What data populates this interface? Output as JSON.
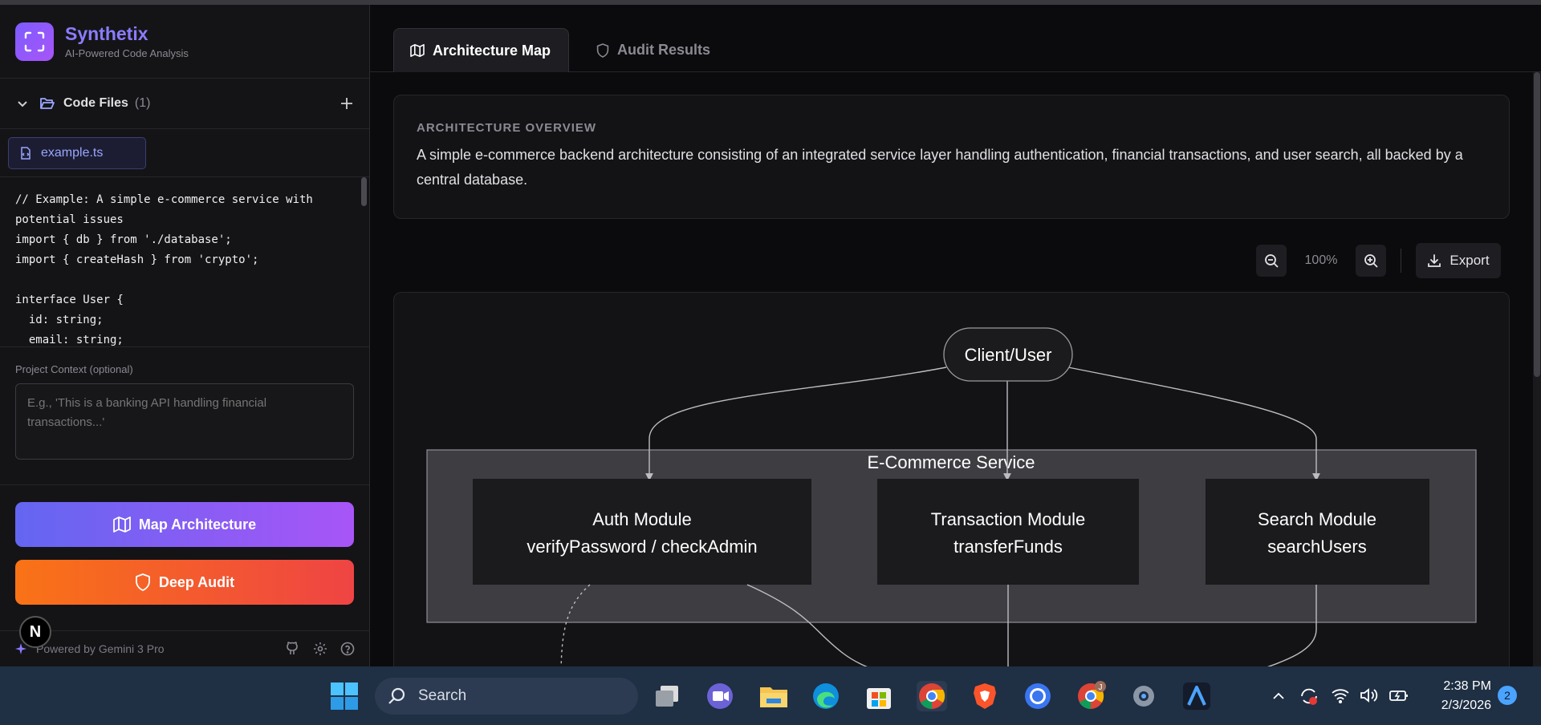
{
  "brand": {
    "name": "Synthetix",
    "tagline": "AI-Powered Code Analysis"
  },
  "files": {
    "label": "Code Files",
    "count": "(1)",
    "active_file": "example.ts"
  },
  "code": {
    "lines": [
      "// Example: A simple e-commerce service with",
      "potential issues",
      "import { db } from './database';",
      "import { createHash } from 'crypto';",
      "",
      "interface User {",
      "  id: string;",
      "  email: string;"
    ]
  },
  "context": {
    "label": "Project Context (optional)",
    "placeholder": "E.g., 'This is a banking API handling financial transactions...'"
  },
  "actions": {
    "map_label": "Map Architecture",
    "audit_label": "Deep Audit"
  },
  "footer": {
    "powered": "Powered by Gemini 3 Pro",
    "badge": "N"
  },
  "tabs": [
    {
      "label": "Architecture Map",
      "active": true
    },
    {
      "label": "Audit Results",
      "active": false
    }
  ],
  "overview": {
    "heading": "ARCHITECTURE OVERVIEW",
    "text": "A simple e-commerce backend architecture consisting of an integrated service layer handling authentication, financial transactions, and user search, all backed by a central database."
  },
  "zoom": {
    "level": "100%",
    "export_label": "Export"
  },
  "diagram": {
    "client": "Client/User",
    "service": "E-Commerce Service",
    "modules": [
      {
        "name": "Auth Module",
        "detail": "verifyPassword / checkAdmin"
      },
      {
        "name": "Transaction Module",
        "detail": "transferFunds"
      },
      {
        "name": "Search Module",
        "detail": "searchUsers"
      }
    ]
  },
  "taskbar": {
    "search_label": "Search",
    "time": "2:38 PM",
    "date": "2/3/2026",
    "notifications": "2",
    "chrome_badge": "J"
  },
  "colors": {
    "accent": "#8b7cff",
    "map_gradient": [
      "#6366f1",
      "#a855f7"
    ],
    "audit_gradient": [
      "#f97316",
      "#ef4444"
    ],
    "node_bg": "#1b1b1d",
    "cluster_bg": "#3d3d42"
  }
}
